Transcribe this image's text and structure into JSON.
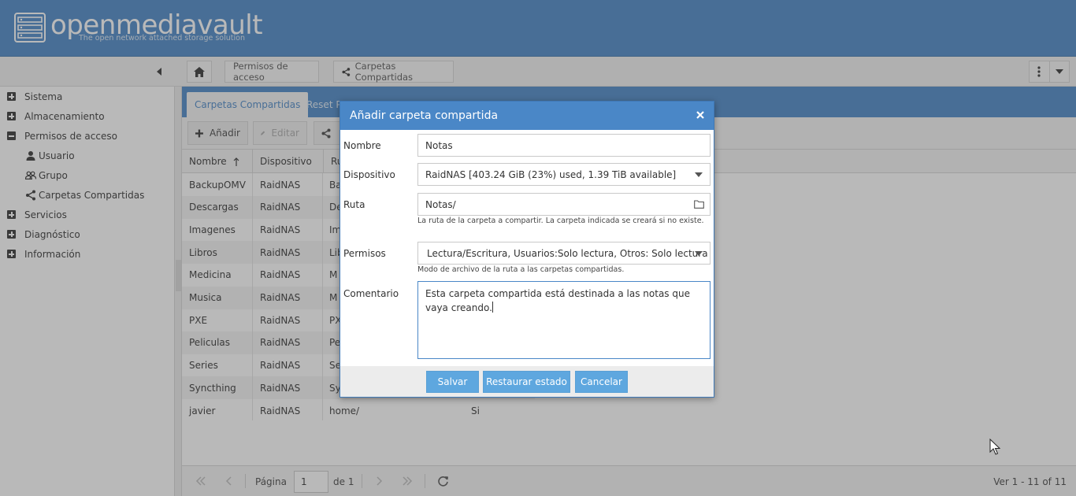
{
  "header": {
    "brand": "openmediavault",
    "tagline": "The open network attached storage solution"
  },
  "breadcrumbs": [
    "Permisos de acceso",
    "Carpetas Compartidas"
  ],
  "sidebar": {
    "items": [
      {
        "label": "Sistema",
        "expanded": false
      },
      {
        "label": "Almacenamiento",
        "expanded": false
      },
      {
        "label": "Permisos de acceso",
        "expanded": true
      },
      {
        "label": "Usuario",
        "sub": true,
        "icon": "user-icon"
      },
      {
        "label": "Grupo",
        "sub": true,
        "icon": "group-icon"
      },
      {
        "label": "Carpetas Compartidas",
        "sub": true,
        "icon": "share-icon"
      },
      {
        "label": "Servicios",
        "expanded": false
      },
      {
        "label": "Diagnóstico",
        "expanded": false
      },
      {
        "label": "Información",
        "expanded": false
      }
    ]
  },
  "tabs": [
    {
      "label": "Carpetas Compartidas",
      "active": true
    },
    {
      "label": "Reset P",
      "active": false
    }
  ],
  "actions": {
    "add_label": "Añadir",
    "edit_label": "Editar"
  },
  "grid": {
    "headers": [
      "Nombre",
      "Dispositivo",
      "Ru"
    ],
    "rows": [
      [
        "BackupOMV",
        "RaidNAS",
        "Ba"
      ],
      [
        "Descargas",
        "RaidNAS",
        "De"
      ],
      [
        "Imagenes",
        "RaidNAS",
        "Im"
      ],
      [
        "Libros",
        "RaidNAS",
        "Lib"
      ],
      [
        "Medicina",
        "RaidNAS",
        "M"
      ],
      [
        "Musica",
        "RaidNAS",
        "M"
      ],
      [
        "PXE",
        "RaidNAS",
        "PX"
      ],
      [
        "Peliculas",
        "RaidNAS",
        "Pe"
      ],
      [
        "Series",
        "RaidNAS",
        "Se"
      ],
      [
        "Syncthing",
        "RaidNAS",
        "Sy"
      ],
      [
        "javier",
        "RaidNAS",
        "home/"
      ]
    ],
    "last_row_extra": "Si"
  },
  "pager": {
    "page_label": "Página",
    "page_value": "1",
    "of_label": "de 1",
    "count": "Ver 1 - 11 of 11"
  },
  "dialog": {
    "title": "Añadir carpeta compartida",
    "name_label": "Nombre",
    "name_value": "Notas",
    "device_label": "Dispositivo",
    "device_value": "RaidNAS [403.24 GiB (23%) used, 1.39 TiB available]",
    "path_label": "Ruta",
    "path_value": "Notas/",
    "path_hint": "La ruta de la carpeta a compartir. La carpeta indicada se creará si no existe.",
    "perm_label": "Permisos",
    "perm_value": "Lectura/Escritura, Usuarios:Solo lectura, Otros: Solo lectura",
    "perm_hint": "Modo de archivo de la ruta a las carpetas compartidas.",
    "comment_label": "Comentario",
    "comment_value": "Esta carpeta compartida está destinada a las notas que vaya creando.",
    "save_label": "Salvar",
    "reset_label": "Restaurar estado",
    "cancel_label": "Cancelar"
  },
  "colors": {
    "brand_blue": "#4a87c7",
    "button_blue": "#5ea7df"
  }
}
